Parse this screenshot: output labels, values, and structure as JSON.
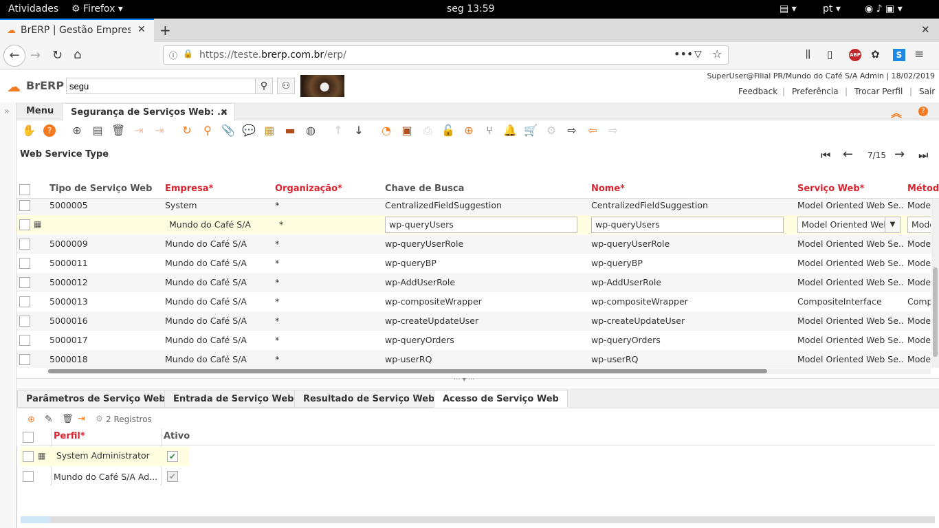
{
  "gnome": {
    "activities": "Atividades",
    "app": "Firefox",
    "clock": "seg 13:59",
    "lang": "pt"
  },
  "firefox": {
    "tab_title": "BrERP | Gestão Empresa",
    "url_prefix": "https://teste.",
    "url_domain": "brerp.com.br",
    "url_path": "/erp/"
  },
  "app": {
    "logo": "BrERP",
    "search_value": "segu",
    "user_info": "SuperUser@Filial PR/Mundo do Café S/A Admin | 18/02/2019",
    "links": [
      "Feedback",
      "Preferência",
      "Trocar Perfil",
      "Sair"
    ],
    "menu_tab": "Menu",
    "window_tab": "Segurança de Serviços Web: ...",
    "section_title": "Web Service Type",
    "record_nav": "7/15"
  },
  "grid": {
    "headers": [
      "Tipo de Serviço Web",
      "Empresa*",
      "Organização*",
      "Chave de Busca",
      "Nome*",
      "Serviço Web*",
      "Métod"
    ],
    "rows": [
      [
        "5000005",
        "System",
        "*",
        "CentralizedFieldSuggestion",
        "CentralizedFieldSuggestion",
        "Model Oriented Web Se...",
        "Model"
      ],
      [
        "",
        "Mundo do Café S/A",
        "*",
        "wp-queryUsers",
        "wp-queryUsers",
        "Model Oriented Web",
        "Mode"
      ],
      [
        "5000009",
        "Mundo do Café S/A",
        "*",
        "wp-queryUserRole",
        "wp-queryUserRole",
        "Model Oriented Web Se...",
        "Model"
      ],
      [
        "5000011",
        "Mundo do Café S/A",
        "*",
        "wp-queryBP",
        "wp-queryBP",
        "Model Oriented Web Se...",
        "Model"
      ],
      [
        "5000012",
        "Mundo do Café S/A",
        "*",
        "wp-AddUserRole",
        "wp-AddUserRole",
        "Model Oriented Web Se...",
        "Model"
      ],
      [
        "5000013",
        "Mundo do Café S/A",
        "*",
        "wp-compositeWrapper",
        "wp-compositeWrapper",
        "CompositeInterface",
        "Comp"
      ],
      [
        "5000016",
        "Mundo do Café S/A",
        "*",
        "wp-createUpdateUser",
        "wp-createUpdateUser",
        "Model Oriented Web Se...",
        "Model"
      ],
      [
        "5000017",
        "Mundo do Café S/A",
        "*",
        "wp-queryOrders",
        "wp-queryOrders",
        "Model Oriented Web Se...",
        "Model"
      ],
      [
        "5000018",
        "Mundo do Café S/A",
        "*",
        "wp-userRQ",
        "wp-userRQ",
        "Model Oriented Web Se...",
        "Model"
      ]
    ]
  },
  "detail": {
    "tabs": [
      "Parâmetros de Serviço Web",
      "Entrada de Serviço Web",
      "Resultado de Serviço Web",
      "Acesso de Serviço Web"
    ],
    "records": "2 Registros",
    "headers": [
      "Perfil*",
      "Ativo"
    ],
    "rows": [
      [
        "System Administrator"
      ],
      [
        "Mundo do Café S/A Ad..."
      ]
    ]
  }
}
